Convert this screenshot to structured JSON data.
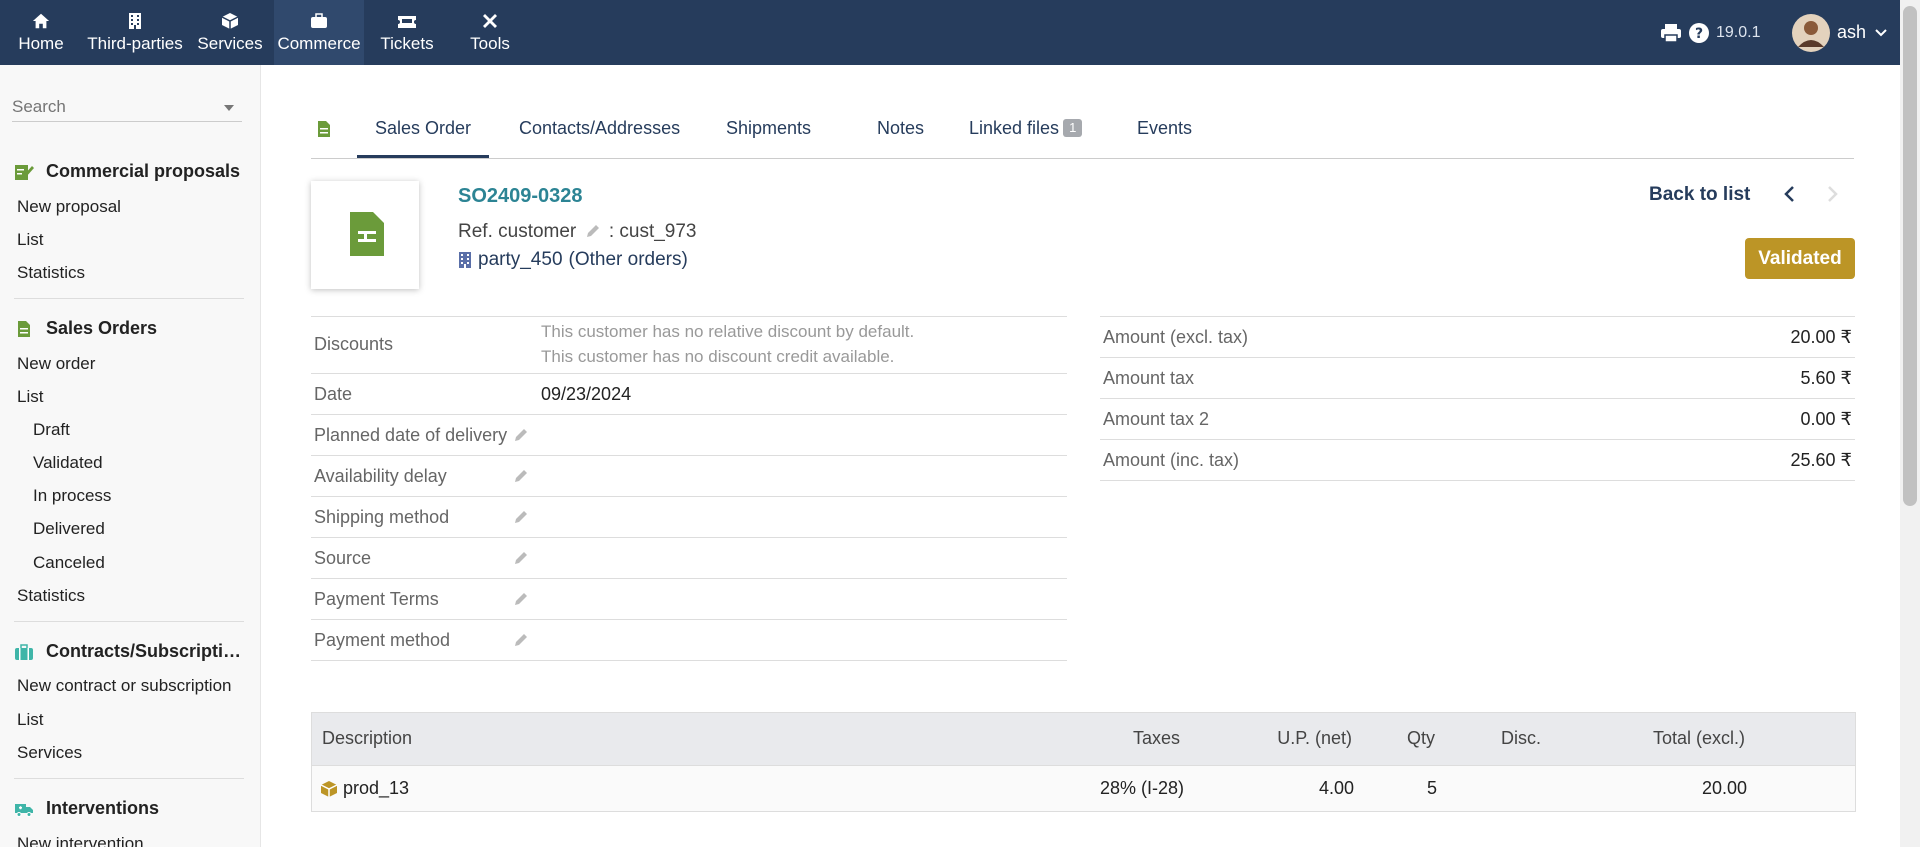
{
  "nav": {
    "items": [
      {
        "label": "Home",
        "icon": "home-icon"
      },
      {
        "label": "Third-parties",
        "icon": "building-icon"
      },
      {
        "label": "Services",
        "icon": "cube-icon"
      },
      {
        "label": "Commerce",
        "icon": "suitcase-icon"
      },
      {
        "label": "Tickets",
        "icon": "ticket-icon"
      },
      {
        "label": "Tools",
        "icon": "tools-icon"
      }
    ],
    "version": "19.0.1",
    "user": "ash"
  },
  "sidebar": {
    "search_placeholder": "Search",
    "sections": [
      {
        "title": "Commercial proposals",
        "links": [
          "New proposal",
          "List",
          "Statistics"
        ]
      },
      {
        "title": "Sales Orders",
        "links": [
          "New order",
          "List"
        ],
        "sublinks": [
          "Draft",
          "Validated",
          "In process",
          "Delivered",
          "Canceled"
        ],
        "after": [
          "Statistics"
        ]
      },
      {
        "title": "Contracts/Subscriptions",
        "links": [
          "New contract or subscription",
          "List",
          "Services"
        ]
      },
      {
        "title": "Interventions",
        "links": [
          "New intervention"
        ]
      }
    ]
  },
  "tabs": {
    "items": [
      "Sales Order",
      "Contacts/Addresses",
      "Shipments",
      "Notes",
      "Linked files",
      "Events"
    ],
    "linked_files_count": "1"
  },
  "order": {
    "ref": "SO2409-0328",
    "ref_customer_label": "Ref. customer",
    "ref_customer_value": ": cust_973",
    "party": "party_450",
    "other_orders": "(Other orders)",
    "back_to_list": "Back to list",
    "status": "Validated",
    "status_color": "#bc9526"
  },
  "fields": {
    "discounts_label": "Discounts",
    "discount_line1": "This customer has no relative discount by default.",
    "discount_line2": "This customer has no discount credit available.",
    "date_label": "Date",
    "date_value": "09/23/2024",
    "planned_delivery_label": "Planned date of delivery",
    "availability_label": "Availability delay",
    "shipping_label": "Shipping method",
    "source_label": "Source",
    "payment_terms_label": "Payment Terms",
    "payment_method_label": "Payment method"
  },
  "amounts": [
    {
      "label": "Amount (excl. tax)",
      "value": "20.00 ₹"
    },
    {
      "label": "Amount tax",
      "value": "5.60 ₹"
    },
    {
      "label": "Amount tax 2",
      "value": "0.00 ₹"
    },
    {
      "label": "Amount (inc. tax)",
      "value": "25.60 ₹"
    }
  ],
  "lines": {
    "headers": {
      "description": "Description",
      "taxes": "Taxes",
      "up": "U.P. (net)",
      "qty": "Qty",
      "disc": "Disc.",
      "total": "Total (excl.)"
    },
    "rows": [
      {
        "description": "prod_13",
        "taxes": "28% (I-28)",
        "up": "4.00",
        "qty": "5",
        "disc": "",
        "total": "20.00"
      }
    ]
  }
}
